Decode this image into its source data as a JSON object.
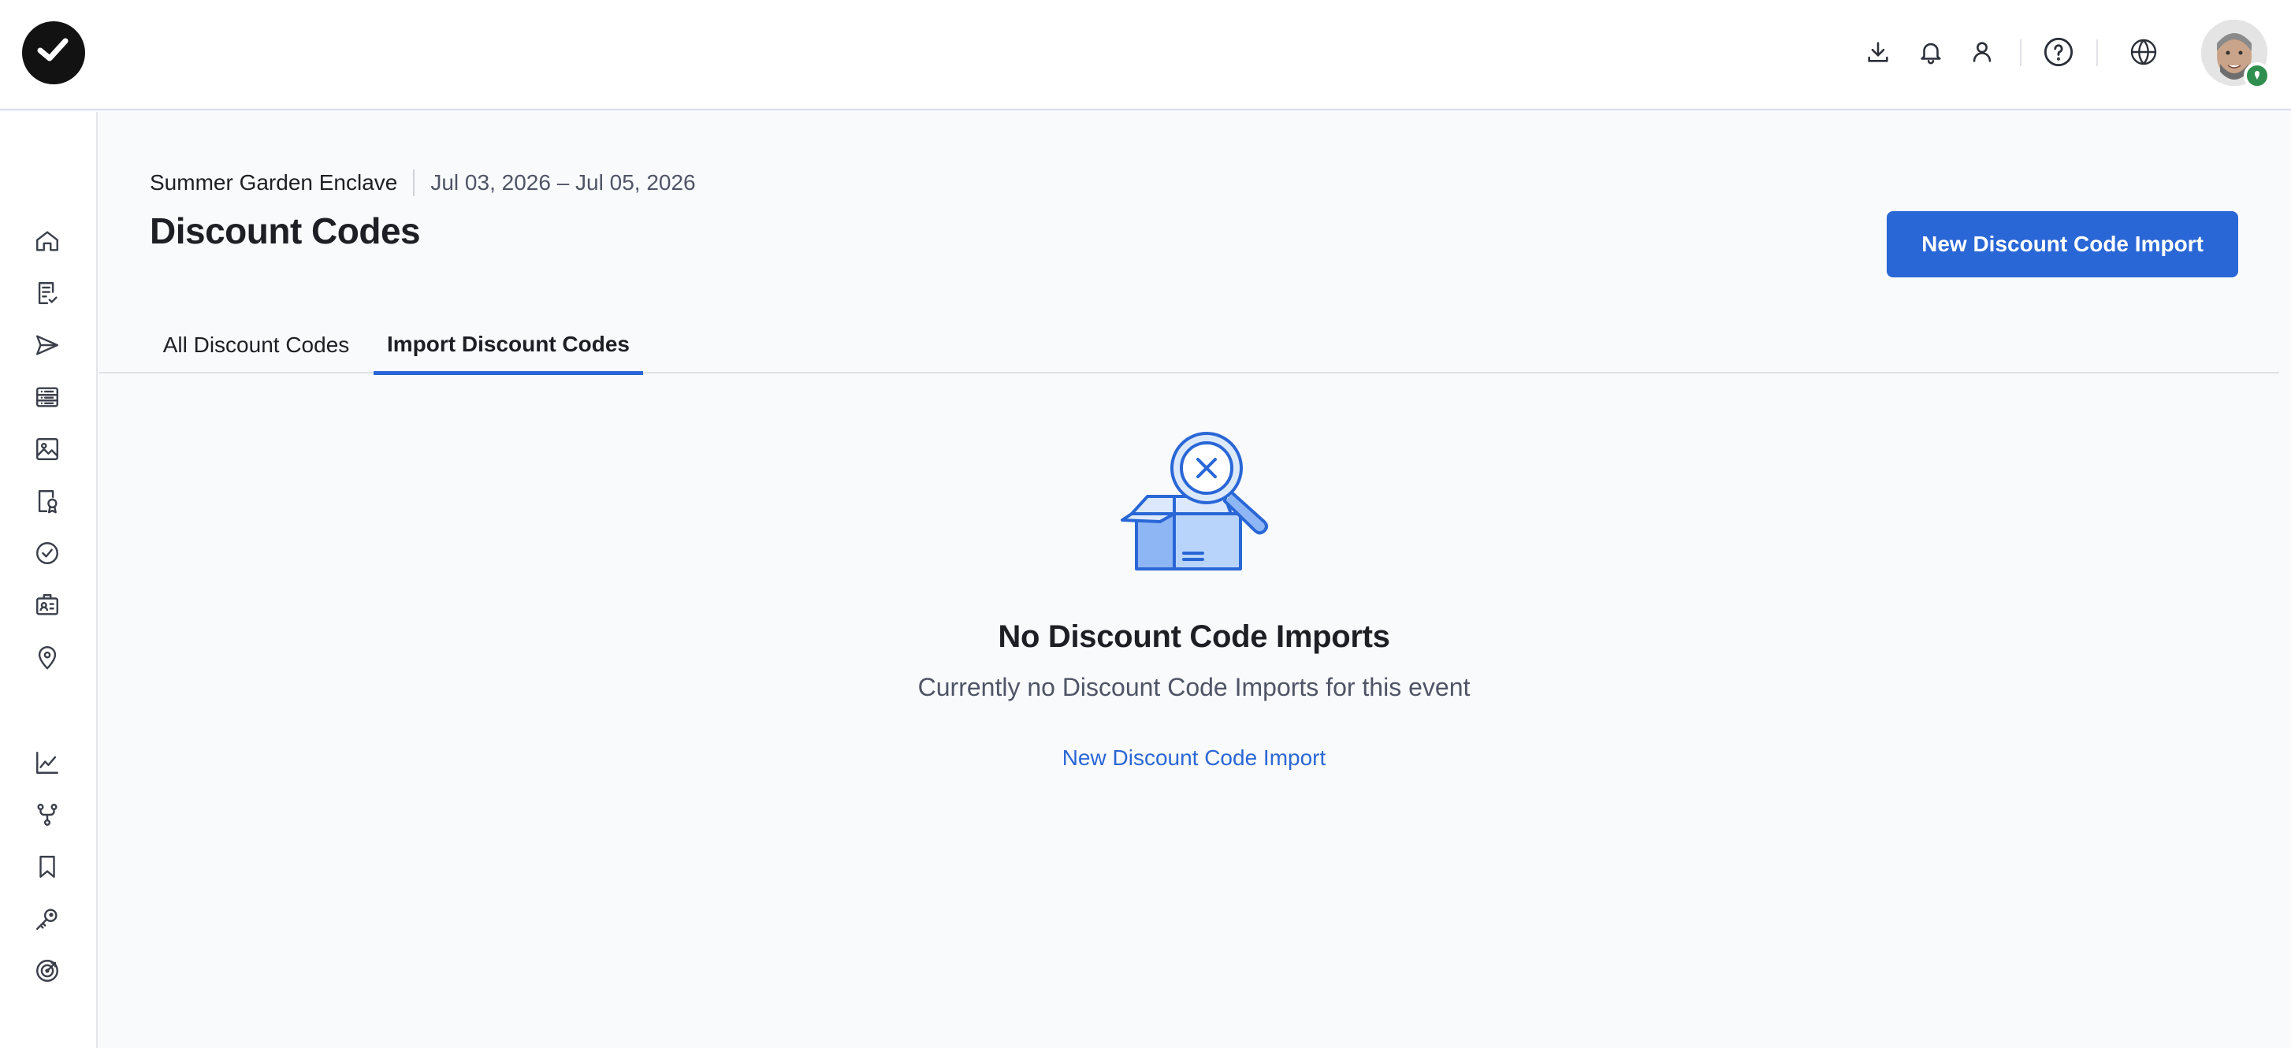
{
  "header": {
    "icons": [
      "download-icon",
      "bell-icon",
      "user-icon",
      "help-icon",
      "globe-icon"
    ]
  },
  "sidebar": {
    "icons": [
      "home-icon",
      "checklist-icon",
      "send-icon",
      "list-icon",
      "image-icon",
      "certificate-icon",
      "badge-check-icon",
      "id-card-icon",
      "location-pin-icon",
      "chart-line-icon",
      "flow-icon",
      "bookmark-icon",
      "key-icon",
      "target-icon"
    ]
  },
  "page": {
    "event_name": "Summer Garden Enclave",
    "dates": "Jul 03, 2026 – Jul 05, 2026",
    "title": "Discount Codes",
    "primary_button": "New Discount Code Import"
  },
  "tabs": [
    {
      "label": "All Discount Codes",
      "active": false
    },
    {
      "label": "Import Discount Codes",
      "active": true
    }
  ],
  "empty_state": {
    "title": "No Discount Code Imports",
    "subtitle": "Currently no Discount Code Imports for this event",
    "link": "New Discount Code Import"
  },
  "colors": {
    "accent": "#2a67d6",
    "illustration_fill": "#b9d4fb",
    "illustration_stroke": "#2a67d6"
  }
}
